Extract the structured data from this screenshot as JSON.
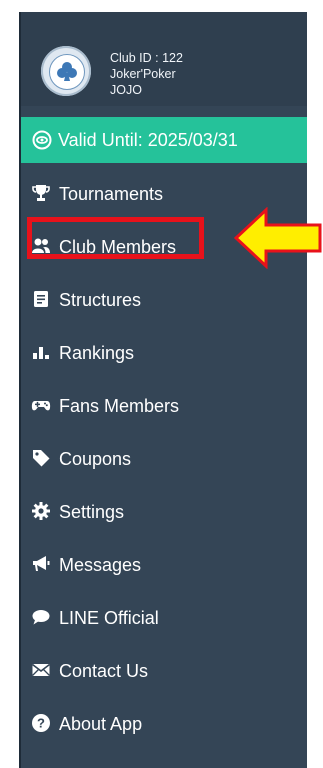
{
  "header": {
    "club_id": "Club ID : 122",
    "club_name": "Joker'Poker",
    "user_name": "JOJO"
  },
  "validity": {
    "label": "Valid Until: 2025/03/31",
    "color": "#25c29a"
  },
  "menu": [
    {
      "label": "Tournaments",
      "icon": "trophy-icon"
    },
    {
      "label": "Club Members",
      "icon": "users-icon",
      "highlighted": true
    },
    {
      "label": "Structures",
      "icon": "document-icon"
    },
    {
      "label": "Rankings",
      "icon": "bar-chart-icon"
    },
    {
      "label": "Fans Members",
      "icon": "gamepad-icon"
    },
    {
      "label": "Coupons",
      "icon": "tag-icon"
    },
    {
      "label": "Settings",
      "icon": "gear-icon"
    },
    {
      "label": "Messages",
      "icon": "megaphone-icon"
    },
    {
      "label": "LINE Official",
      "icon": "chat-bubble-icon"
    },
    {
      "label": "Contact Us",
      "icon": "envelope-icon"
    },
    {
      "label": "About App",
      "icon": "question-icon"
    }
  ],
  "colors": {
    "sidebar_bg": "#344556",
    "annotation_red": "#e8121b",
    "arrow_yellow": "#ffee00"
  }
}
